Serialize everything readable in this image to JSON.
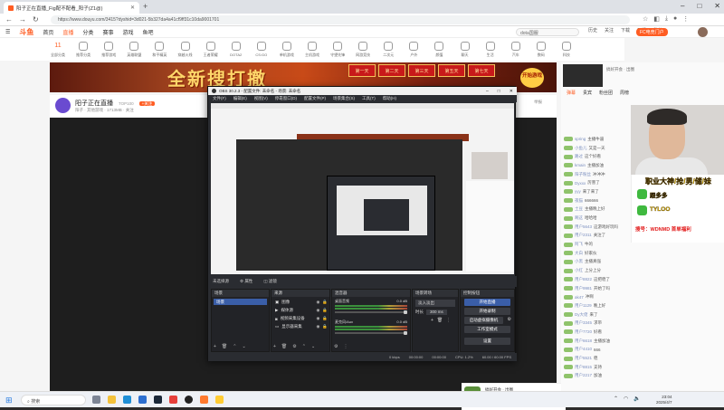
{
  "browser": {
    "tab_title": "阳子正在直播_Fig配不配看_阳子(Z1@)",
    "url": "https://www.douyu.com/3415?dyshid=3d021-5b327da4a41cf9ff31c10da9001701",
    "new_tab_label": "+",
    "icons": {
      "back": "back-icon",
      "forward": "forward-icon",
      "reload": "reload-icon"
    }
  },
  "site": {
    "logo": "斗鱼",
    "nav": [
      "首页",
      "直播",
      "分类",
      "赛事",
      "游戏",
      "鱼吧"
    ],
    "search_placeholder": "dota国服",
    "header_icons": [
      "历史",
      "关注",
      "下载",
      "开播",
      "私信",
      "消息"
    ],
    "fchan_label": "FC电竞门户",
    "categories": [
      "11",
      "推荐分类",
      "推荐游戏",
      "英雄联盟",
      "和平精英",
      "穿越火线",
      "王者荣耀",
      "DOTA2",
      "CS:GO",
      "单机游戏",
      "主机游戏",
      "守望先锋",
      "网游竞技",
      "二次元",
      "户外",
      "颜值",
      "聊天",
      "生活",
      "汽车",
      "数码",
      "科技",
      "知识",
      "音乐",
      "舞蹈",
      "体育",
      "中超",
      "教育",
      "娱乐"
    ],
    "category_top": "11",
    "category_top_sub": "全部分类"
  },
  "banner": {
    "title": "全新搜打撤",
    "days": [
      "第一天",
      "第二天",
      "第三天",
      "第五天",
      "第七天"
    ],
    "start_label": "开始游戏"
  },
  "streamer": {
    "name": "阳子正在直播",
    "tag": "TOP100",
    "follow": "+关注",
    "sub": "阳子 · 其他游戏 · 1713MB · 关注",
    "right_text": "举报"
  },
  "obs": {
    "title": "OBS 30.2.3 - 配置文件: 未命名 - 场景: 未命名",
    "menu": [
      "文件(F)",
      "编辑(E)",
      "视图(V)",
      "停靠窗口(D)",
      "配置文件(P)",
      "场景集合(S)",
      "工具(T)",
      "帮助(H)"
    ],
    "mid_bar": [
      "未选择源",
      "属性",
      "滤镜"
    ],
    "scenes_header": "场景",
    "scenes": [
      "场景"
    ],
    "sources_header": "来源",
    "sources": [
      "图像",
      "媒体源",
      "视频采集设备",
      "显示器采集"
    ],
    "mixer_header": "混音器",
    "mixer": [
      {
        "name": "桌面音频",
        "db": "0.0 dB"
      },
      {
        "name": "麦克风/Aux",
        "db": "0.0 dB"
      }
    ],
    "transition_header": "场景转场",
    "transition_value": "淡入淡出",
    "duration_label": "时长",
    "duration_value": "300 ms",
    "controls_header": "控制按钮",
    "controls": [
      "开始直播",
      "开始录制",
      "启动虚拟摄像机",
      "工作室模式",
      "设置",
      "退出"
    ],
    "status": [
      "0 kbps",
      "00:00:00",
      "00:00:00",
      "CPU: 1.2%",
      "60.00 / 60.00 FPS"
    ]
  },
  "chat": {
    "tabs": [
      "弹幕",
      "贵宾",
      "粉丝团",
      "周榜"
    ],
    "lines": [
      {
        "nick": "spring",
        "msg": "主播牛逼"
      },
      {
        "nick": "小鱼儿",
        "msg": "又是一天"
      },
      {
        "nick": "路过",
        "msg": "这个好看"
      },
      {
        "nick": "kmain",
        "msg": "主播加油"
      },
      {
        "nick": "阳子粉丝",
        "msg": "冲冲冲"
      },
      {
        "nick": "Dyxxx",
        "msg": "厉害了"
      },
      {
        "nick": "yyy",
        "msg": "来了来了"
      },
      {
        "nick": "夜猫",
        "msg": "666666"
      },
      {
        "nick": "土豆",
        "msg": "主播晚上好"
      },
      {
        "nick": "啊这",
        "msg": "哈哈哈"
      },
      {
        "nick": "用户5643",
        "msg": "这游戏好玩吗"
      },
      {
        "nick": "用户2311",
        "msg": "关注了"
      },
      {
        "nick": "阿飞",
        "msg": "牛的"
      },
      {
        "nick": "大白",
        "msg": "好家伙"
      },
      {
        "nick": "小黑",
        "msg": "主播真强"
      },
      {
        "nick": "小红",
        "msg": "上分上分"
      },
      {
        "nick": "用户8822",
        "msg": "这把稳了"
      },
      {
        "nick": "用户9981",
        "msg": "开始了吗"
      },
      {
        "nick": "ak47",
        "msg": "冲啊"
      },
      {
        "nick": "用户1129",
        "msg": "晚上好"
      },
      {
        "nick": "Dy大佬",
        "msg": "来了"
      },
      {
        "nick": "用户3345",
        "msg": "求带"
      },
      {
        "nick": "用户7720",
        "msg": "好看"
      },
      {
        "nick": "用户6618",
        "msg": "主播加油"
      },
      {
        "nick": "用户4410",
        "msg": "666"
      },
      {
        "nick": "用户5521",
        "msg": "稳"
      },
      {
        "nick": "用户8815",
        "msg": "支持"
      },
      {
        "nick": "用户2217",
        "msg": "加油"
      }
    ],
    "input_placeholder": "这里输入聊天内容"
  },
  "promo": {
    "title": "职业大神/抢/男/储/妹",
    "line1": "跟多多",
    "line2": "TYLOO",
    "foot": "搜号：WDNMD 首单福利"
  },
  "user_card": {
    "name": "搞好开会 · 出圈",
    "btn1": "主页/开播",
    "btn2": "送礼"
  },
  "taskbar": {
    "search_placeholder": "搜索",
    "time": "23:04",
    "date": "2025/4/7"
  }
}
